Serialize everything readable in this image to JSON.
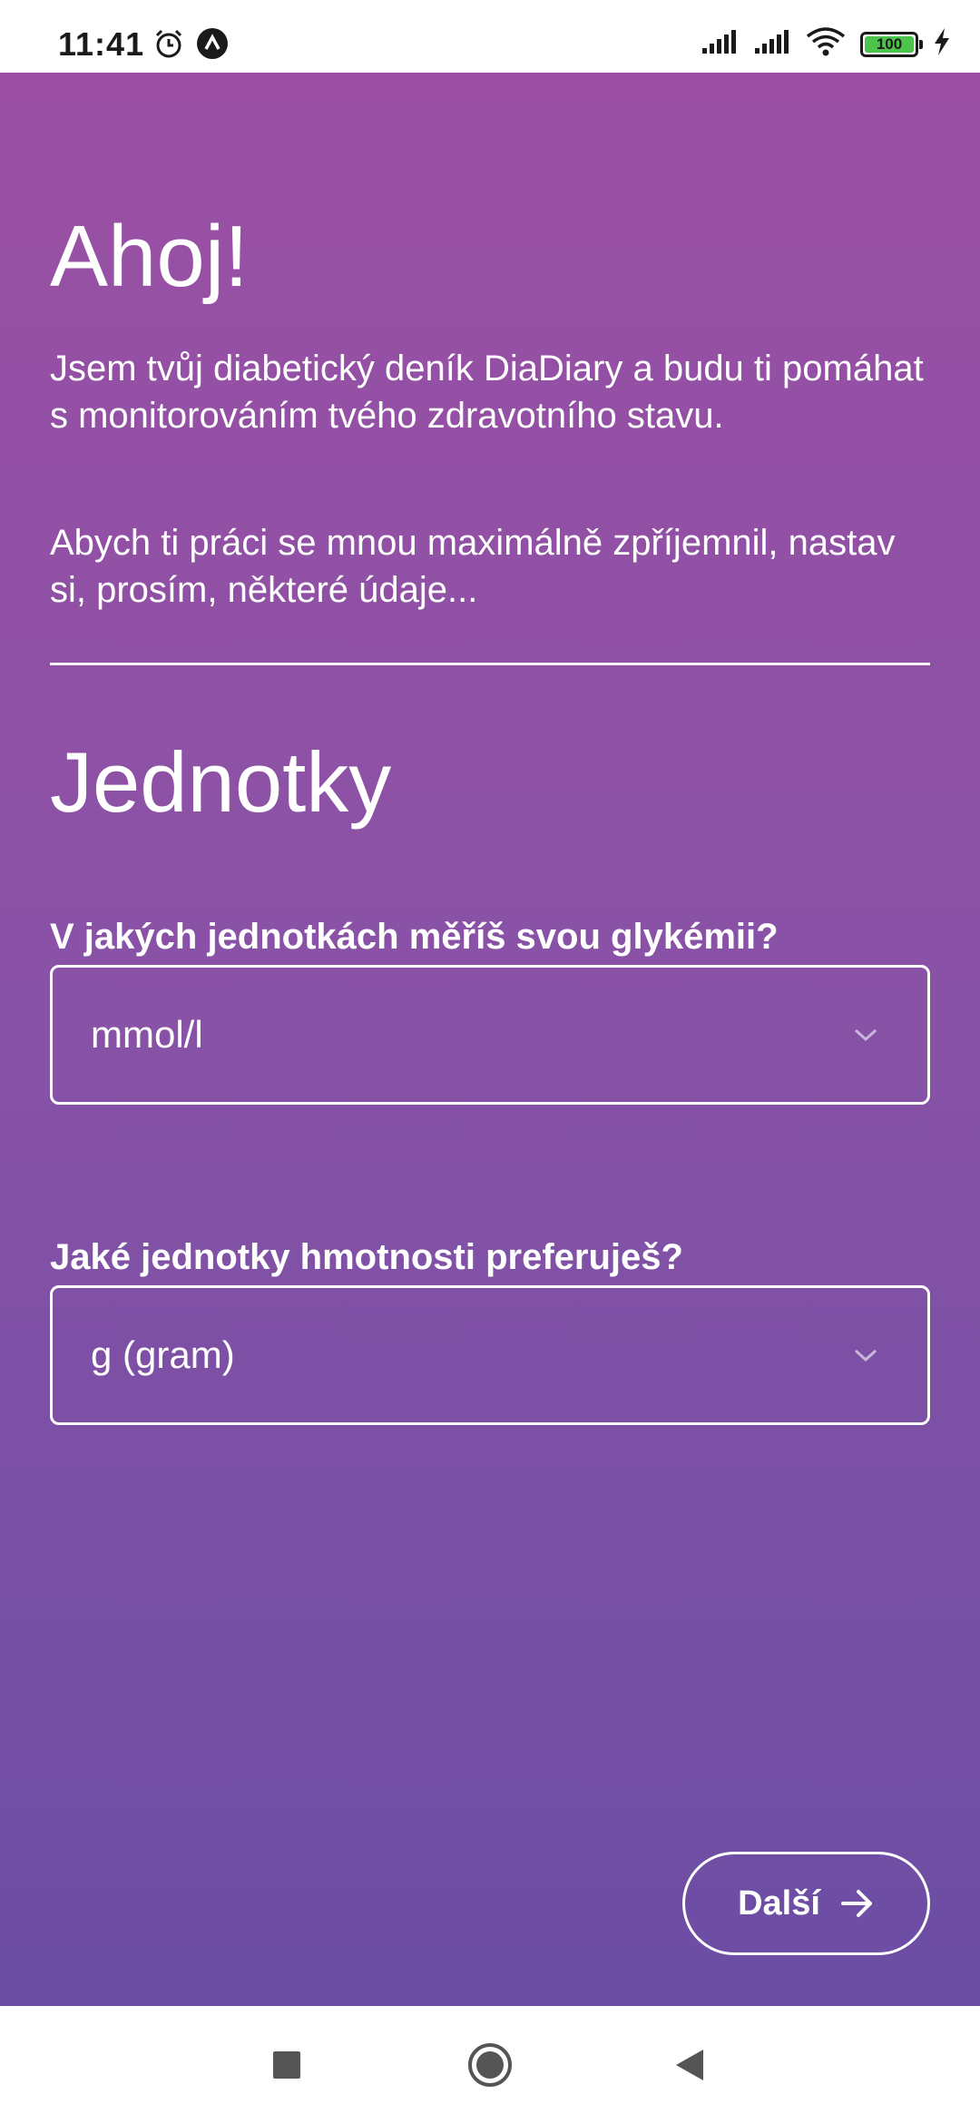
{
  "status_bar": {
    "time": "11:41",
    "battery_level": "100",
    "icons": [
      "alarm-icon",
      "app-notification-icon",
      "signal-icon",
      "signal-icon",
      "wifi-icon",
      "battery-icon",
      "charging-icon"
    ]
  },
  "welcome": {
    "title": "Ahoj!",
    "intro": "Jsem tvůj diabetický deník DiaDiary a budu ti pomáhat s monitorováním tvého zdravotního stavu.",
    "intro2": "Abych ti práci se mnou maximálně zpříjemnil, nastav si, prosím, některé údaje..."
  },
  "units_section": {
    "title": "Jednotky",
    "glycemia": {
      "label": "V jakých jednotkách měříš svou glykémii?",
      "selected": "mmol/l"
    },
    "weight": {
      "label": "Jaké jednotky hmotnosti preferuješ?",
      "selected": "g (gram)"
    }
  },
  "next_button": {
    "label": "Další"
  },
  "colors": {
    "gradient_top": "#9a4fa4",
    "gradient_bottom": "#6b4ea4",
    "text": "#ffffff"
  }
}
